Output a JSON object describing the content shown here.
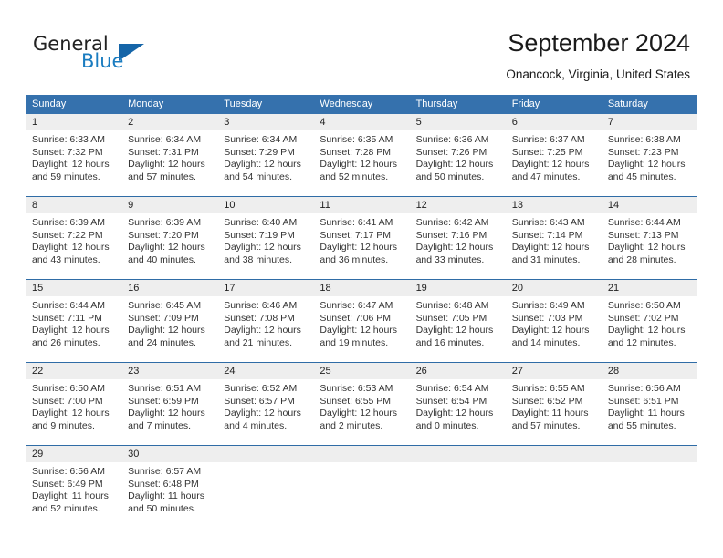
{
  "brand": {
    "name_part1": "General",
    "name_part2": "Blue",
    "logo_icon": "triangle-logo-icon",
    "accent_color": "#1a7cc0"
  },
  "header": {
    "title": "September 2024",
    "subtitle": "Onancock, Virginia, United States"
  },
  "calendar": {
    "header_bg_color": "#3571ad",
    "daynum_bg_color": "#eeeeee",
    "weekdays": [
      "Sunday",
      "Monday",
      "Tuesday",
      "Wednesday",
      "Thursday",
      "Friday",
      "Saturday"
    ],
    "weeks": [
      {
        "days": [
          {
            "num": "1",
            "sunrise": "Sunrise: 6:33 AM",
            "sunset": "Sunset: 7:32 PM",
            "daylight1": "Daylight: 12 hours",
            "daylight2": "and 59 minutes."
          },
          {
            "num": "2",
            "sunrise": "Sunrise: 6:34 AM",
            "sunset": "Sunset: 7:31 PM",
            "daylight1": "Daylight: 12 hours",
            "daylight2": "and 57 minutes."
          },
          {
            "num": "3",
            "sunrise": "Sunrise: 6:34 AM",
            "sunset": "Sunset: 7:29 PM",
            "daylight1": "Daylight: 12 hours",
            "daylight2": "and 54 minutes."
          },
          {
            "num": "4",
            "sunrise": "Sunrise: 6:35 AM",
            "sunset": "Sunset: 7:28 PM",
            "daylight1": "Daylight: 12 hours",
            "daylight2": "and 52 minutes."
          },
          {
            "num": "5",
            "sunrise": "Sunrise: 6:36 AM",
            "sunset": "Sunset: 7:26 PM",
            "daylight1": "Daylight: 12 hours",
            "daylight2": "and 50 minutes."
          },
          {
            "num": "6",
            "sunrise": "Sunrise: 6:37 AM",
            "sunset": "Sunset: 7:25 PM",
            "daylight1": "Daylight: 12 hours",
            "daylight2": "and 47 minutes."
          },
          {
            "num": "7",
            "sunrise": "Sunrise: 6:38 AM",
            "sunset": "Sunset: 7:23 PM",
            "daylight1": "Daylight: 12 hours",
            "daylight2": "and 45 minutes."
          }
        ]
      },
      {
        "days": [
          {
            "num": "8",
            "sunrise": "Sunrise: 6:39 AM",
            "sunset": "Sunset: 7:22 PM",
            "daylight1": "Daylight: 12 hours",
            "daylight2": "and 43 minutes."
          },
          {
            "num": "9",
            "sunrise": "Sunrise: 6:39 AM",
            "sunset": "Sunset: 7:20 PM",
            "daylight1": "Daylight: 12 hours",
            "daylight2": "and 40 minutes."
          },
          {
            "num": "10",
            "sunrise": "Sunrise: 6:40 AM",
            "sunset": "Sunset: 7:19 PM",
            "daylight1": "Daylight: 12 hours",
            "daylight2": "and 38 minutes."
          },
          {
            "num": "11",
            "sunrise": "Sunrise: 6:41 AM",
            "sunset": "Sunset: 7:17 PM",
            "daylight1": "Daylight: 12 hours",
            "daylight2": "and 36 minutes."
          },
          {
            "num": "12",
            "sunrise": "Sunrise: 6:42 AM",
            "sunset": "Sunset: 7:16 PM",
            "daylight1": "Daylight: 12 hours",
            "daylight2": "and 33 minutes."
          },
          {
            "num": "13",
            "sunrise": "Sunrise: 6:43 AM",
            "sunset": "Sunset: 7:14 PM",
            "daylight1": "Daylight: 12 hours",
            "daylight2": "and 31 minutes."
          },
          {
            "num": "14",
            "sunrise": "Sunrise: 6:44 AM",
            "sunset": "Sunset: 7:13 PM",
            "daylight1": "Daylight: 12 hours",
            "daylight2": "and 28 minutes."
          }
        ]
      },
      {
        "days": [
          {
            "num": "15",
            "sunrise": "Sunrise: 6:44 AM",
            "sunset": "Sunset: 7:11 PM",
            "daylight1": "Daylight: 12 hours",
            "daylight2": "and 26 minutes."
          },
          {
            "num": "16",
            "sunrise": "Sunrise: 6:45 AM",
            "sunset": "Sunset: 7:09 PM",
            "daylight1": "Daylight: 12 hours",
            "daylight2": "and 24 minutes."
          },
          {
            "num": "17",
            "sunrise": "Sunrise: 6:46 AM",
            "sunset": "Sunset: 7:08 PM",
            "daylight1": "Daylight: 12 hours",
            "daylight2": "and 21 minutes."
          },
          {
            "num": "18",
            "sunrise": "Sunrise: 6:47 AM",
            "sunset": "Sunset: 7:06 PM",
            "daylight1": "Daylight: 12 hours",
            "daylight2": "and 19 minutes."
          },
          {
            "num": "19",
            "sunrise": "Sunrise: 6:48 AM",
            "sunset": "Sunset: 7:05 PM",
            "daylight1": "Daylight: 12 hours",
            "daylight2": "and 16 minutes."
          },
          {
            "num": "20",
            "sunrise": "Sunrise: 6:49 AM",
            "sunset": "Sunset: 7:03 PM",
            "daylight1": "Daylight: 12 hours",
            "daylight2": "and 14 minutes."
          },
          {
            "num": "21",
            "sunrise": "Sunrise: 6:50 AM",
            "sunset": "Sunset: 7:02 PM",
            "daylight1": "Daylight: 12 hours",
            "daylight2": "and 12 minutes."
          }
        ]
      },
      {
        "days": [
          {
            "num": "22",
            "sunrise": "Sunrise: 6:50 AM",
            "sunset": "Sunset: 7:00 PM",
            "daylight1": "Daylight: 12 hours",
            "daylight2": "and 9 minutes."
          },
          {
            "num": "23",
            "sunrise": "Sunrise: 6:51 AM",
            "sunset": "Sunset: 6:59 PM",
            "daylight1": "Daylight: 12 hours",
            "daylight2": "and 7 minutes."
          },
          {
            "num": "24",
            "sunrise": "Sunrise: 6:52 AM",
            "sunset": "Sunset: 6:57 PM",
            "daylight1": "Daylight: 12 hours",
            "daylight2": "and 4 minutes."
          },
          {
            "num": "25",
            "sunrise": "Sunrise: 6:53 AM",
            "sunset": "Sunset: 6:55 PM",
            "daylight1": "Daylight: 12 hours",
            "daylight2": "and 2 minutes."
          },
          {
            "num": "26",
            "sunrise": "Sunrise: 6:54 AM",
            "sunset": "Sunset: 6:54 PM",
            "daylight1": "Daylight: 12 hours",
            "daylight2": "and 0 minutes."
          },
          {
            "num": "27",
            "sunrise": "Sunrise: 6:55 AM",
            "sunset": "Sunset: 6:52 PM",
            "daylight1": "Daylight: 11 hours",
            "daylight2": "and 57 minutes."
          },
          {
            "num": "28",
            "sunrise": "Sunrise: 6:56 AM",
            "sunset": "Sunset: 6:51 PM",
            "daylight1": "Daylight: 11 hours",
            "daylight2": "and 55 minutes."
          }
        ]
      },
      {
        "days": [
          {
            "num": "29",
            "sunrise": "Sunrise: 6:56 AM",
            "sunset": "Sunset: 6:49 PM",
            "daylight1": "Daylight: 11 hours",
            "daylight2": "and 52 minutes."
          },
          {
            "num": "30",
            "sunrise": "Sunrise: 6:57 AM",
            "sunset": "Sunset: 6:48 PM",
            "daylight1": "Daylight: 11 hours",
            "daylight2": "and 50 minutes."
          },
          {
            "num": "",
            "sunrise": "",
            "sunset": "",
            "daylight1": "",
            "daylight2": ""
          },
          {
            "num": "",
            "sunrise": "",
            "sunset": "",
            "daylight1": "",
            "daylight2": ""
          },
          {
            "num": "",
            "sunrise": "",
            "sunset": "",
            "daylight1": "",
            "daylight2": ""
          },
          {
            "num": "",
            "sunrise": "",
            "sunset": "",
            "daylight1": "",
            "daylight2": ""
          },
          {
            "num": "",
            "sunrise": "",
            "sunset": "",
            "daylight1": "",
            "daylight2": ""
          }
        ]
      }
    ]
  }
}
